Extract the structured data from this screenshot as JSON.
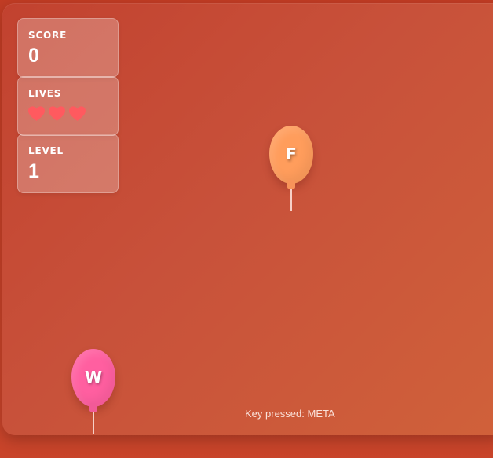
{
  "hud": {
    "score": {
      "label": "SCORE",
      "value": "0"
    },
    "lives": {
      "label": "LIVES",
      "count": 3,
      "heart_color": "#ff5a5f"
    },
    "level": {
      "label": "LEVEL",
      "value": "1"
    }
  },
  "balloons": [
    {
      "letter": "F",
      "color": "#ff9d5c",
      "knot_color": "#f7935a"
    },
    {
      "letter": "W",
      "color": "#ff5fa0",
      "knot_color": "#f25a97"
    }
  ],
  "status": {
    "key_pressed_text": "Key pressed: META"
  },
  "colors": {
    "accent": "#c8462f",
    "hud_card": "rgba(255,255,255,0.25)"
  }
}
